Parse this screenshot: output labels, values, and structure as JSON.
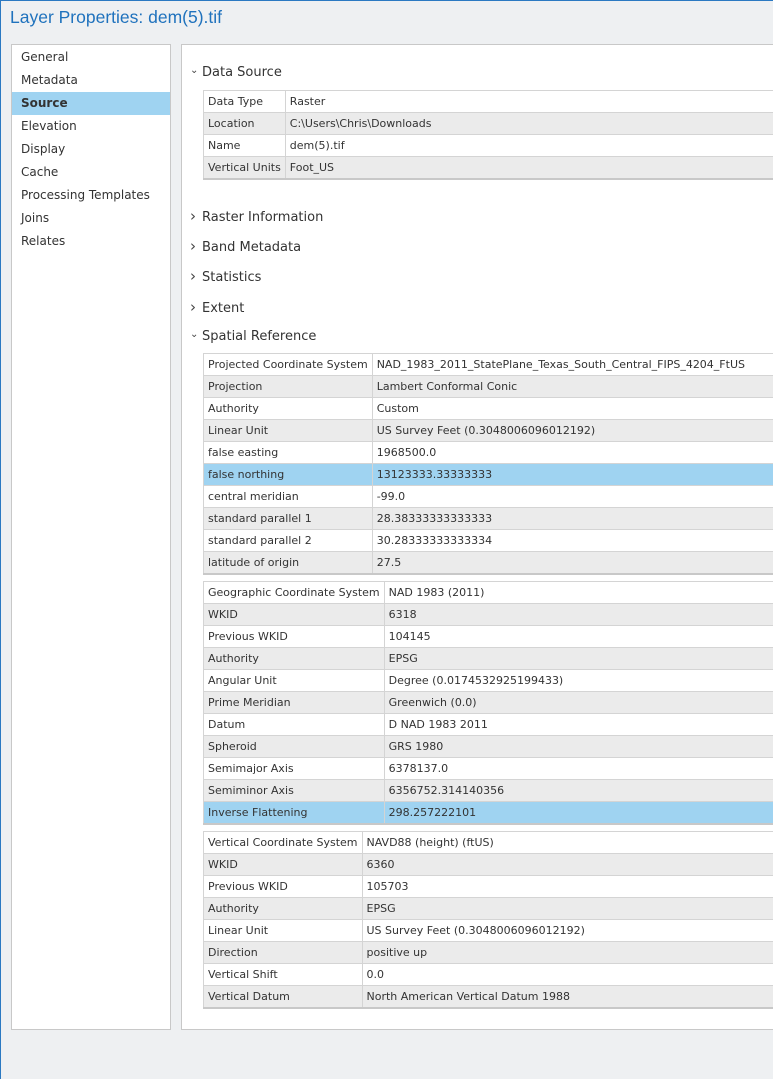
{
  "title": "Layer Properties: dem(5).tif",
  "sidebar": {
    "items": [
      {
        "label": "General"
      },
      {
        "label": "Metadata"
      },
      {
        "label": "Source",
        "active": true
      },
      {
        "label": "Elevation"
      },
      {
        "label": "Display"
      },
      {
        "label": "Cache"
      },
      {
        "label": "Processing Templates"
      },
      {
        "label": "Joins"
      },
      {
        "label": "Relates"
      }
    ]
  },
  "colors": {
    "accent": "#1f72bd",
    "selection": "#9fd3f1",
    "alt_row": "#ebebeb"
  },
  "sections": [
    {
      "label": "Data Source",
      "expanded": true
    },
    {
      "label": "Raster Information",
      "expanded": false
    },
    {
      "label": "Band Metadata",
      "expanded": false
    },
    {
      "label": "Statistics",
      "expanded": false
    },
    {
      "label": "Extent",
      "expanded": false
    },
    {
      "label": "Spatial Reference",
      "expanded": true
    }
  ],
  "tables": [
    {
      "rows": [
        [
          "Data Type",
          "Raster"
        ],
        [
          "Location",
          "C:\\Users\\Chris\\Downloads"
        ],
        [
          "Name",
          "dem(5).tif"
        ],
        [
          "Vertical Units",
          "Foot_US"
        ]
      ]
    },
    {
      "rows": [
        [
          "Projected Coordinate System",
          "NAD_1983_2011_StatePlane_Texas_South_Central_FIPS_4204_FtUS"
        ],
        [
          "Projection",
          "Lambert Conformal Conic"
        ],
        [
          "Authority",
          "Custom"
        ],
        [
          "Linear Unit",
          "US Survey Feet (0.3048006096012192)"
        ],
        [
          "false easting",
          "1968500.0"
        ],
        [
          "false northing",
          "13123333.33333333"
        ],
        [
          "central meridian",
          "-99.0"
        ],
        [
          "standard parallel 1",
          "28.38333333333333"
        ],
        [
          "standard parallel 2",
          "30.28333333333334"
        ],
        [
          "latitude of origin",
          "27.5"
        ]
      ],
      "selected": 5
    },
    {
      "rows": [
        [
          "Geographic Coordinate System",
          "NAD 1983 (2011)"
        ],
        [
          "WKID",
          "6318"
        ],
        [
          "Previous WKID",
          "104145"
        ],
        [
          "Authority",
          "EPSG"
        ],
        [
          "Angular Unit",
          "Degree (0.0174532925199433)"
        ],
        [
          "Prime Meridian",
          "Greenwich (0.0)"
        ],
        [
          "Datum",
          "D NAD 1983 2011"
        ],
        [
          "Spheroid",
          "GRS 1980"
        ],
        [
          "Semimajor Axis",
          "6378137.0"
        ],
        [
          "Semiminor Axis",
          "6356752.314140356"
        ],
        [
          "Inverse Flattening",
          "298.257222101"
        ]
      ],
      "selected": 10
    },
    {
      "rows": [
        [
          "Vertical Coordinate System",
          "NAVD88 (height) (ftUS)"
        ],
        [
          "WKID",
          "6360"
        ],
        [
          "Previous WKID",
          "105703"
        ],
        [
          "Authority",
          "EPSG"
        ],
        [
          "Linear Unit",
          "US Survey Feet (0.3048006096012192)"
        ],
        [
          "Direction",
          "positive up"
        ],
        [
          "Vertical Shift",
          "0.0"
        ],
        [
          "Vertical Datum",
          "North American Vertical Datum 1988"
        ]
      ]
    }
  ]
}
